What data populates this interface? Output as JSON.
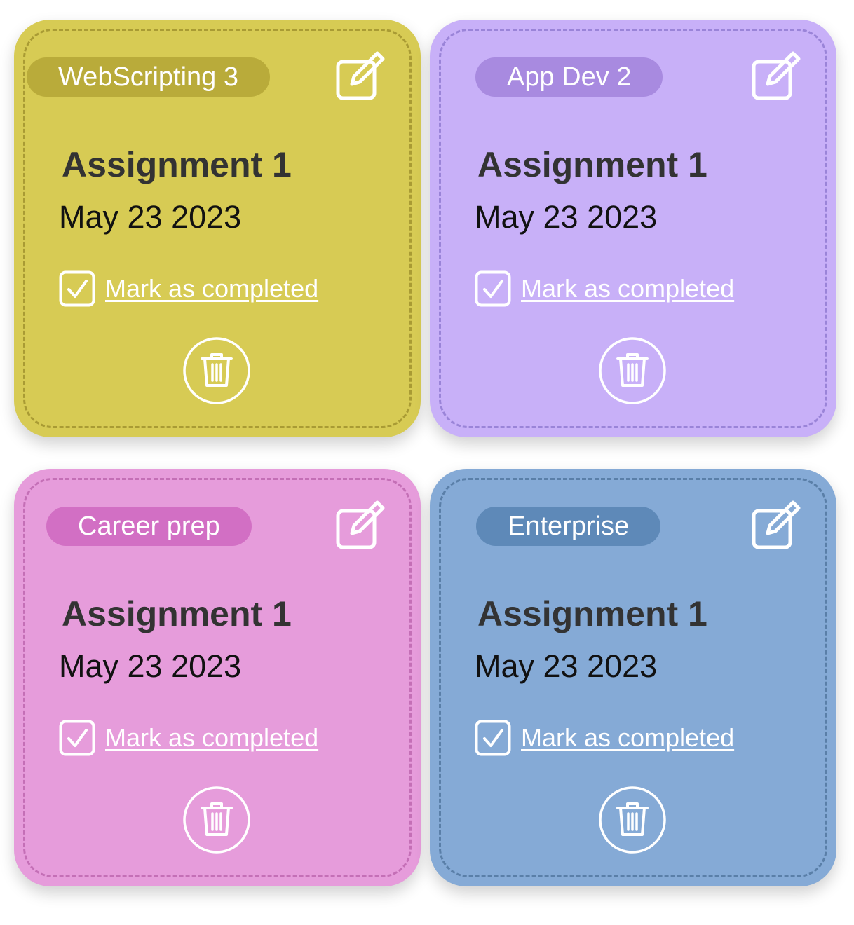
{
  "cards": [
    {
      "tag": "WebScripting 3",
      "title": "Assignment 1",
      "date": "May 23 2023",
      "complete_label": "Mark as completed",
      "colors": {
        "bg": "#d7cb54",
        "tag": "#b9ab3a",
        "dash": "#a99b34"
      }
    },
    {
      "tag": "App Dev 2",
      "title": "Assignment 1",
      "date": "May 23 2023",
      "complete_label": "Mark as completed",
      "colors": {
        "bg": "#c8b0f8",
        "tag": "#a88ae0",
        "dash": "#9a84d8"
      }
    },
    {
      "tag": "Career prep",
      "title": "Assignment 1",
      "date": "May 23 2023",
      "complete_label": "Mark as completed",
      "colors": {
        "bg": "#e69cdb",
        "tag": "#d26fc4",
        "dash": "#c46fb6"
      }
    },
    {
      "tag": "Enterprise",
      "title": "Assignment 1",
      "date": "May 23 2023",
      "complete_label": "Mark as completed",
      "colors": {
        "bg": "#85aad6",
        "tag": "#5e89b8",
        "dash": "#5a7fa8"
      }
    }
  ],
  "icons": {
    "edit": "edit-icon",
    "check": "checkbox-checked-icon",
    "delete": "trash-icon"
  }
}
